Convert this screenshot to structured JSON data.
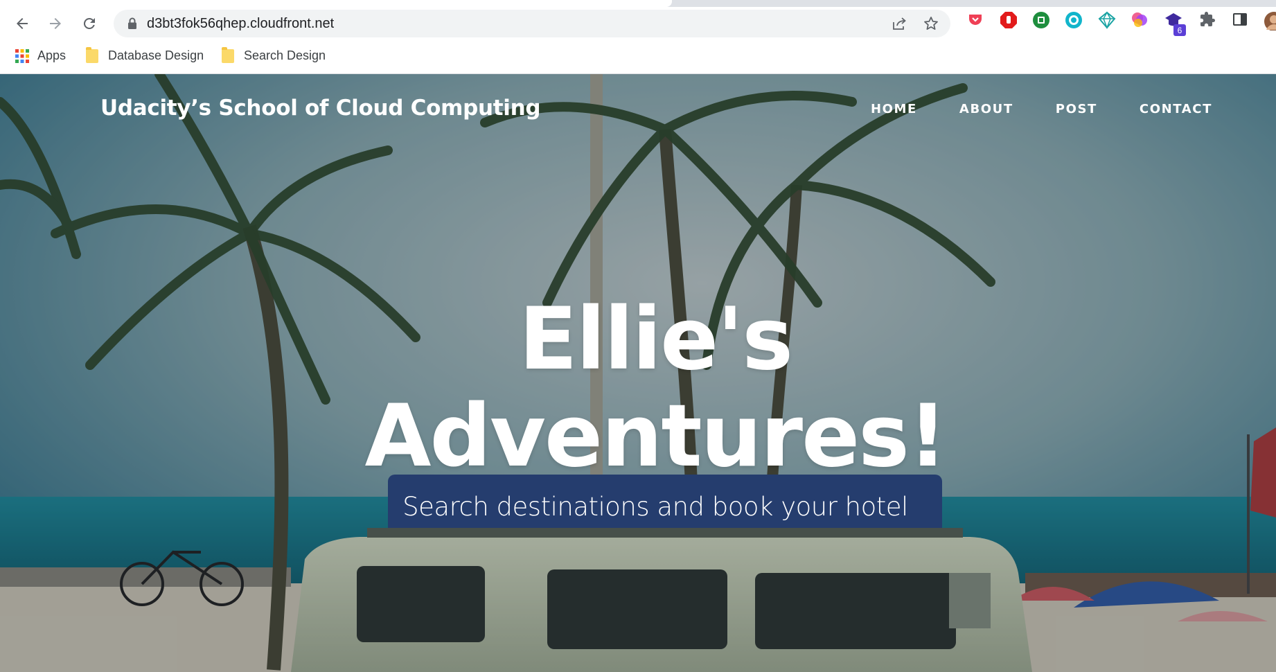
{
  "browser": {
    "url": "d3bt3fok56qhep.cloudfront.net",
    "icons": {
      "back": "arrow-left-icon",
      "forward": "arrow-right-icon",
      "reload": "reload-icon",
      "lock": "lock-icon",
      "share": "share-icon",
      "bookmark": "star-icon"
    },
    "extensions": [
      {
        "name": "pocket-icon",
        "color": "#ef4056"
      },
      {
        "name": "adblock-icon",
        "color": "#e21b1b"
      },
      {
        "name": "green-extension-icon",
        "color": "#1e8e3e"
      },
      {
        "name": "teal-extension-icon",
        "color": "#12b5cb"
      },
      {
        "name": "diamond-extension-icon",
        "color": "#1aa3a3"
      },
      {
        "name": "colorful-extension-icon",
        "color": "#a142f4"
      },
      {
        "name": "graduation-cap-icon",
        "color": "#3f2a9e",
        "badge": "6"
      },
      {
        "name": "puzzle-icon",
        "color": "#5f6368"
      },
      {
        "name": "side-panel-icon",
        "color": "#3c4043"
      }
    ],
    "bookmarks": [
      {
        "label": "Apps",
        "icon": "apps-grid-icon"
      },
      {
        "label": "Database Design",
        "icon": "folder-icon"
      },
      {
        "label": "Search Design",
        "icon": "folder-icon"
      }
    ]
  },
  "site": {
    "brand": "Udacity’s School of Cloud Computing",
    "nav": [
      "HOME",
      "ABOUT",
      "POST",
      "CONTACT"
    ],
    "headline_line1": "Ellie's",
    "headline_line2": "Adventures!",
    "subheading": "Search destinations and book your hotel"
  }
}
